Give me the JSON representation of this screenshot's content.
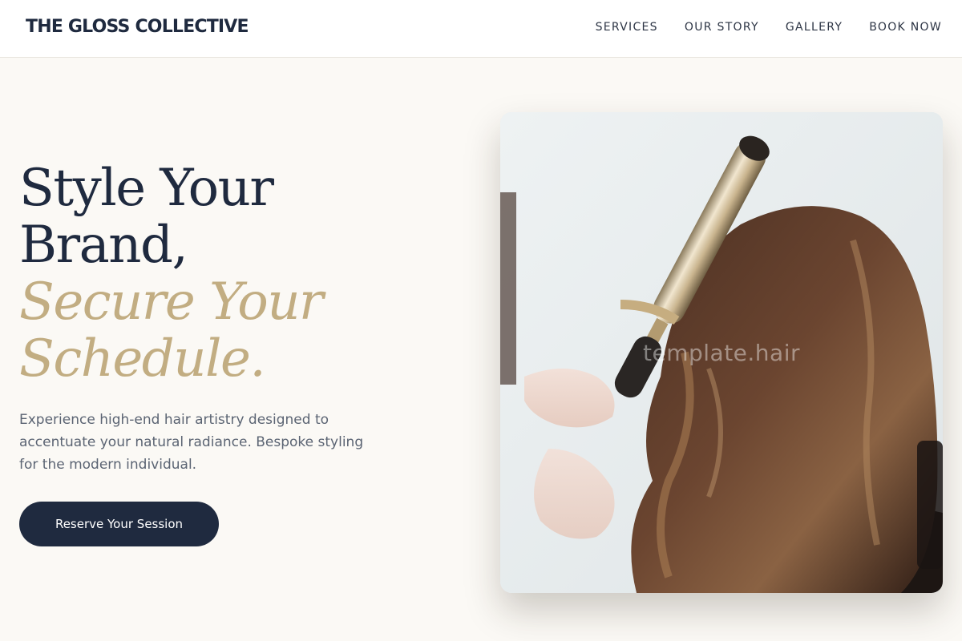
{
  "header": {
    "brand": "THE GLOSS COLLECTIVE",
    "nav": [
      {
        "label": "SERVICES"
      },
      {
        "label": "OUR STORY"
      },
      {
        "label": "GALLERY"
      },
      {
        "label": "BOOK NOW"
      }
    ]
  },
  "hero": {
    "title_line1": "Style Your",
    "title_line2": "Brand,",
    "accent_line1": "Secure Your",
    "accent_line2": "Schedule.",
    "description": "Experience high-end hair artistry designed to accentuate your natural radiance. Bespoke styling for the modern individual.",
    "cta_label": "Reserve Your Session",
    "image_watermark": "template.hair"
  },
  "colors": {
    "primary": "#1f2a3f",
    "accent": "#c2ad82",
    "background": "#fbf9f5",
    "body_text": "#5b6473"
  },
  "icons": {
    "hero_image": "hair-styling-photo"
  }
}
